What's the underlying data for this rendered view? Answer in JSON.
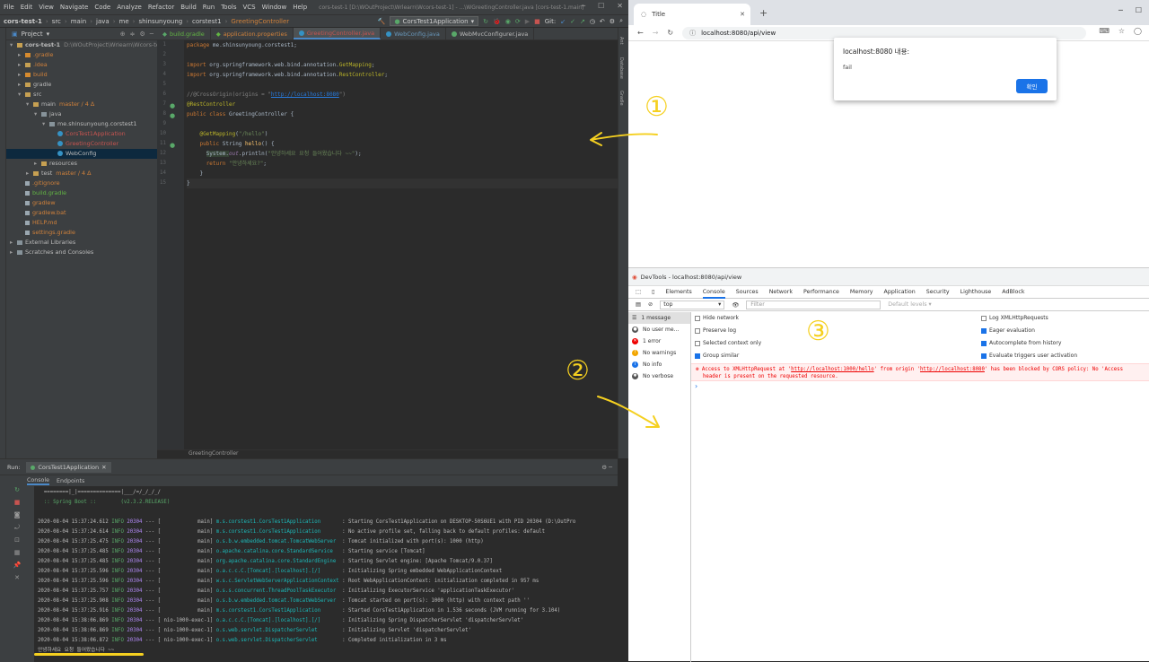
{
  "ide": {
    "menu": [
      "File",
      "Edit",
      "View",
      "Navigate",
      "Code",
      "Analyze",
      "Refactor",
      "Build",
      "Run",
      "Tools",
      "VCS",
      "Window",
      "Help"
    ],
    "window_title": "cors-test-1 [D:\\WOutProject\\Wrlearn\\Wcors-test-1] - ...\\WGreetingController.java [cors-test-1.main]",
    "breadcrumbs": [
      "cors-test-1",
      "src",
      "main",
      "java",
      "me",
      "shinsunyoung",
      "corstest1",
      "GreetingController"
    ],
    "run_config": "CorsTest1Application",
    "git_label": "Git:",
    "project_header": "Project",
    "tree": [
      {
        "label": "cors-test-1",
        "extra": "D:\\WOutProject\\Wrlearn\\Wcors-test",
        "indent": 0,
        "type": "module"
      },
      {
        "label": ".gradle",
        "indent": 1,
        "type": "folder-o",
        "color": "orange"
      },
      {
        "label": ".idea",
        "indent": 1,
        "type": "folder",
        "color": "orange"
      },
      {
        "label": "build",
        "indent": 1,
        "type": "folder-o",
        "color": "orange"
      },
      {
        "label": "gradle",
        "indent": 1,
        "type": "folder"
      },
      {
        "label": "src",
        "indent": 1,
        "type": "folder"
      },
      {
        "label": "main",
        "extra": "master / 4 Δ",
        "indent": 2,
        "type": "folder"
      },
      {
        "label": "java",
        "indent": 3,
        "type": "folder-b"
      },
      {
        "label": "me.shinsunyoung.corstest1",
        "indent": 4,
        "type": "folder-b"
      },
      {
        "label": "CorsTest1Application",
        "indent": 5,
        "type": "class",
        "color": "red"
      },
      {
        "label": "GreetingController",
        "indent": 5,
        "type": "class",
        "color": "red"
      },
      {
        "label": "WebConfig",
        "indent": 5,
        "type": "class",
        "selected": true
      },
      {
        "label": "resources",
        "indent": 3,
        "type": "folder"
      },
      {
        "label": "test",
        "extra": "master / 4 Δ",
        "indent": 2,
        "type": "folder"
      },
      {
        "label": ".gitignore",
        "indent": 1,
        "type": "file",
        "color": "orange"
      },
      {
        "label": "build.gradle",
        "indent": 1,
        "type": "file",
        "color": "green"
      },
      {
        "label": "gradlew",
        "indent": 1,
        "type": "file",
        "color": "orange"
      },
      {
        "label": "gradlew.bat",
        "indent": 1,
        "type": "file",
        "color": "orange"
      },
      {
        "label": "HELP.md",
        "indent": 1,
        "type": "file",
        "color": "orange"
      },
      {
        "label": "settings.gradle",
        "indent": 1,
        "type": "file",
        "color": "orange"
      },
      {
        "label": "External Libraries",
        "indent": 0,
        "type": "lib"
      },
      {
        "label": "Scratches and Consoles",
        "indent": 0,
        "type": "lib"
      }
    ],
    "editor_tabs": [
      {
        "label": "build.gradle",
        "active": false
      },
      {
        "label": "application.properties",
        "active": false
      },
      {
        "label": "GreetingController.java",
        "active": true
      },
      {
        "label": "WebConfig.java",
        "active": false
      },
      {
        "label": "WebMvcConfigurer.java",
        "active": false
      }
    ],
    "code_lines": [
      "1",
      "2",
      "3",
      "4",
      "5",
      "6",
      "7",
      "8",
      "9",
      "10",
      "11",
      "12",
      "13",
      "14",
      "15"
    ],
    "code": {
      "l1_kw": "package ",
      "l1_rest": "me.shinsunyoung.corstest1;",
      "l3_kw": "import ",
      "l3_rest": "org.springframework.web.bind.annotation.",
      "l3_an": "GetMapping",
      "l4_kw": "import ",
      "l4_rest": "org.springframework.web.bind.annotation.",
      "l4_an": "RestController",
      "l6_cm": "//@CrossOrigin(origins = \"",
      "l6_lk": "http://localhost:8080",
      "l6_cm2": "\")",
      "l7_an": "@RestController",
      "l8_kw": "public class ",
      "l8_rest": "GreetingController {",
      "l10_an": "@GetMapping",
      "l10_rest": "(",
      "l10_st": "\"/hello\"",
      "l10_end": ")",
      "l11_kw": "public ",
      "l11_rest": "String ",
      "l11_fn": "hello",
      "l11_end": "() {",
      "l12_sys": "System.",
      "l12_out": "out",
      "l12_rest": ".println(",
      "l12_st": "\"안녕하세요 요청 들어왔습니다 ~~\"",
      "l12_end": ");",
      "l13_kw": "return ",
      "l13_st": "\"안녕하세요?\"",
      "l13_end": ";",
      "l14": "}",
      "l15": "}"
    },
    "breadcrumb_bottom": "GreetingController",
    "run": {
      "label": "Run:",
      "tab": "CorsTest1Application",
      "subtabs": [
        "Console",
        "Endpoints"
      ],
      "banner1": "  ========|_|==============|___/=/_/_/_/",
      "banner2": "  :: Spring Boot ::        (v2.3.2.RELEASE)",
      "logs": [
        {
          "ts": "2020-08-04 15:37:24.612",
          "lvl": "INFO",
          "pid": "20304",
          "sep": "--- [",
          "thread": "           main]",
          "logger": "m.s.corstest1.CorsTest1Application      ",
          "msg": ": Starting CorsTest1Application on DESKTOP-50S6UE1 with PID 20304 (D:\\OutPro"
        },
        {
          "ts": "2020-08-04 15:37:24.614",
          "lvl": "INFO",
          "pid": "20304",
          "sep": "--- [",
          "thread": "           main]",
          "logger": "m.s.corstest1.CorsTest1Application      ",
          "msg": ": No active profile set, falling back to default profiles: default"
        },
        {
          "ts": "2020-08-04 15:37:25.475",
          "lvl": "INFO",
          "pid": "20304",
          "sep": "--- [",
          "thread": "           main]",
          "logger": "o.s.b.w.embedded.tomcat.TomcatWebServer ",
          "msg": ": Tomcat initialized with port(s): 1000 (http)"
        },
        {
          "ts": "2020-08-04 15:37:25.485",
          "lvl": "INFO",
          "pid": "20304",
          "sep": "--- [",
          "thread": "           main]",
          "logger": "o.apache.catalina.core.StandardService  ",
          "msg": ": Starting service [Tomcat]"
        },
        {
          "ts": "2020-08-04 15:37:25.485",
          "lvl": "INFO",
          "pid": "20304",
          "sep": "--- [",
          "thread": "           main]",
          "logger": "org.apache.catalina.core.StandardEngine ",
          "msg": ": Starting Servlet engine: [Apache Tomcat/9.0.37]"
        },
        {
          "ts": "2020-08-04 15:37:25.596",
          "lvl": "INFO",
          "pid": "20304",
          "sep": "--- [",
          "thread": "           main]",
          "logger": "o.a.c.c.C.[Tomcat].[localhost].[/]      ",
          "msg": ": Initializing Spring embedded WebApplicationContext"
        },
        {
          "ts": "2020-08-04 15:37:25.596",
          "lvl": "INFO",
          "pid": "20304",
          "sep": "--- [",
          "thread": "           main]",
          "logger": "w.s.c.ServletWebServerApplicationContext",
          "msg": ": Root WebApplicationContext: initialization completed in 957 ms"
        },
        {
          "ts": "2020-08-04 15:37:25.757",
          "lvl": "INFO",
          "pid": "20304",
          "sep": "--- [",
          "thread": "           main]",
          "logger": "o.s.s.concurrent.ThreadPoolTaskExecutor ",
          "msg": ": Initializing ExecutorService 'applicationTaskExecutor'"
        },
        {
          "ts": "2020-08-04 15:37:25.908",
          "lvl": "INFO",
          "pid": "20304",
          "sep": "--- [",
          "thread": "           main]",
          "logger": "o.s.b.w.embedded.tomcat.TomcatWebServer ",
          "msg": ": Tomcat started on port(s): 1000 (http) with context path ''"
        },
        {
          "ts": "2020-08-04 15:37:25.916",
          "lvl": "INFO",
          "pid": "20304",
          "sep": "--- [",
          "thread": "           main]",
          "logger": "m.s.corstest1.CorsTest1Application      ",
          "msg": ": Started CorsTest1Application in 1.536 seconds (JVM running for 3.104)"
        },
        {
          "ts": "2020-08-04 15:38:06.869",
          "lvl": "INFO",
          "pid": "20304",
          "sep": "--- [",
          "thread": "nio-1000-exec-1]",
          "logger": "o.a.c.c.C.[Tomcat].[localhost].[/]      ",
          "msg": ": Initializing Spring DispatcherServlet 'dispatcherServlet'"
        },
        {
          "ts": "2020-08-04 15:38:06.869",
          "lvl": "INFO",
          "pid": "20304",
          "sep": "--- [",
          "thread": "nio-1000-exec-1]",
          "logger": "o.s.web.servlet.DispatcherServlet       ",
          "msg": ": Initializing Servlet 'dispatcherServlet'"
        },
        {
          "ts": "2020-08-04 15:38:06.872",
          "lvl": "INFO",
          "pid": "20304",
          "sep": "--- [",
          "thread": "nio-1000-exec-1]",
          "logger": "o.s.web.servlet.DispatcherServlet       ",
          "msg": ": Completed initialization in 3 ms"
        }
      ],
      "last_line": "안녕하세요 요청 들어왔습니다 ~~"
    }
  },
  "browser": {
    "tab_title": "Title",
    "url": "localhost:8080/api/view",
    "alert": {
      "title": "localhost:8080 내용:",
      "message": "fail",
      "ok": "확인"
    }
  },
  "devtools": {
    "title": "DevTools - localhost:8080/api/view",
    "tabs": [
      "Elements",
      "Console",
      "Sources",
      "Network",
      "Performance",
      "Memory",
      "Application",
      "Security",
      "Lighthouse",
      "AdBlock"
    ],
    "context": "top",
    "filter_placeholder": "Filter",
    "levels": "Default levels ▾",
    "sidebar": [
      {
        "label": "1 message",
        "icon": "list"
      },
      {
        "label": "No user me...",
        "icon": "user"
      },
      {
        "label": "1 error",
        "icon": "error"
      },
      {
        "label": "No warnings",
        "icon": "warning"
      },
      {
        "label": "No info",
        "icon": "info"
      },
      {
        "label": "No verbose",
        "icon": "verbose"
      }
    ],
    "options_left": [
      {
        "label": "Hide network",
        "checked": false
      },
      {
        "label": "Preserve log",
        "checked": false
      },
      {
        "label": "Selected context only",
        "checked": false
      },
      {
        "label": "Group similar",
        "checked": true
      }
    ],
    "options_right": [
      {
        "label": "Log XMLHttpRequests",
        "checked": false
      },
      {
        "label": "Eager evaluation",
        "checked": true
      },
      {
        "label": "Autocomplete from history",
        "checked": true
      },
      {
        "label": "Evaluate triggers user activation",
        "checked": true
      }
    ],
    "error": {
      "p1": "Access to XMLHttpRequest at '",
      "u1": "http://localhost:1000/hello",
      "p2": "' from origin '",
      "u2": "http://localhost:8080",
      "p3": "' has been blocked by CORS policy: No 'Access",
      "p4": "header is present on the requested resource."
    }
  },
  "annotations": {
    "one": "①",
    "two": "②",
    "three": "③"
  },
  "colors": {
    "annotation": "#f5d020",
    "ide_bg": "#2b2b2b",
    "accent": "#1a73e8",
    "error": "#e00000"
  }
}
